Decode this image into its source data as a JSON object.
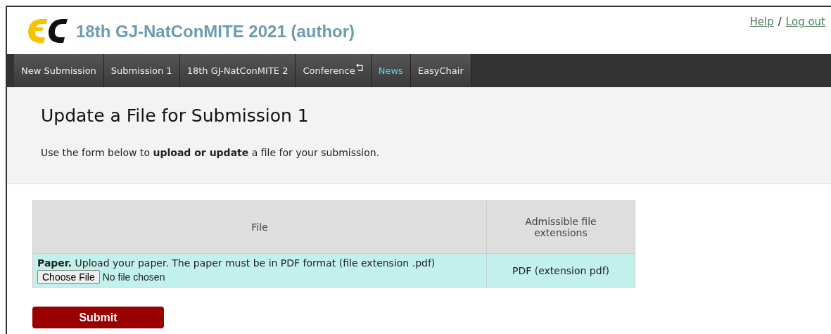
{
  "header": {
    "title": "18th GJ-NatConMITE 2021 (author)",
    "links": [
      "Help",
      "Log out"
    ],
    "separator": "/"
  },
  "nav": [
    {
      "label": "New Submission",
      "highlighted": false,
      "has_menu_icon": false
    },
    {
      "label": "Submission 1",
      "highlighted": false,
      "has_menu_icon": false
    },
    {
      "label": "18th GJ-NatConMITE 2",
      "highlighted": false,
      "has_menu_icon": false
    },
    {
      "label": "Conference",
      "highlighted": false,
      "has_menu_icon": true
    },
    {
      "label": "News",
      "highlighted": true,
      "has_menu_icon": false
    },
    {
      "label": "EasyChair",
      "highlighted": false,
      "has_menu_icon": false
    }
  ],
  "intro": {
    "heading": "Update a File for Submission 1",
    "text": "Use the form below to **upload or update** a file for your submission."
  },
  "table": {
    "columns": [
      "File",
      "Admissible file extensions"
    ],
    "rows": [
      {
        "description": "**Paper.** Upload your paper. The paper must be in PDF format (file extension .pdf)",
        "button": "Choose File",
        "status": "No file chosen",
        "extensions": "PDF (extension pdf)"
      }
    ]
  },
  "submit": "Submit"
}
